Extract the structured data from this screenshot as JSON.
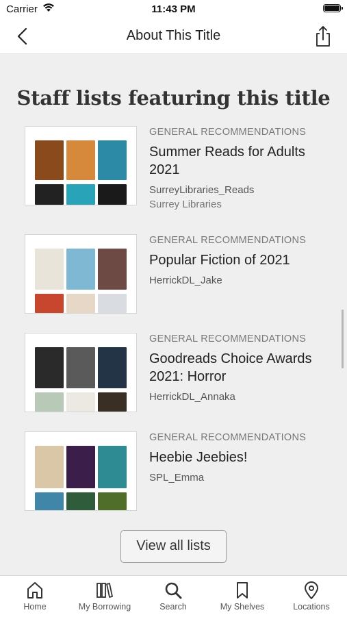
{
  "status_bar": {
    "carrier": "Carrier",
    "time": "11:43 PM"
  },
  "nav": {
    "title": "About This Title",
    "back_icon": "chevron-left-icon",
    "share_icon": "share-icon"
  },
  "section": {
    "title": "Staff lists featuring this title"
  },
  "lists": [
    {
      "category": "GENERAL RECOMMENDATIONS",
      "title": "Summer Reads for Adults 2021",
      "author": "SurreyLibraries_Reads",
      "library": "Surrey Libraries"
    },
    {
      "category": "GENERAL RECOMMENDATIONS",
      "title": "Popular Fiction of 2021",
      "author": "HerrickDL_Jake",
      "library": ""
    },
    {
      "category": "GENERAL RECOMMENDATIONS",
      "title": "Goodreads Choice Awards 2021: Horror",
      "author": "HerrickDL_Annaka",
      "library": ""
    },
    {
      "category": "GENERAL RECOMMENDATIONS",
      "title": "Heebie Jeebies!",
      "author": "SPL_Emma",
      "library": ""
    }
  ],
  "view_all_label": "View all lists",
  "tabs": [
    {
      "label": "Home",
      "icon": "home-icon"
    },
    {
      "label": "My Borrowing",
      "icon": "books-icon"
    },
    {
      "label": "Search",
      "icon": "search-icon"
    },
    {
      "label": "My Shelves",
      "icon": "bookmark-icon"
    },
    {
      "label": "Locations",
      "icon": "map-pin-icon"
    }
  ],
  "colors": {
    "background": "#efefef",
    "bar": "#ffffff",
    "text": "#222222",
    "muted": "#777777"
  }
}
